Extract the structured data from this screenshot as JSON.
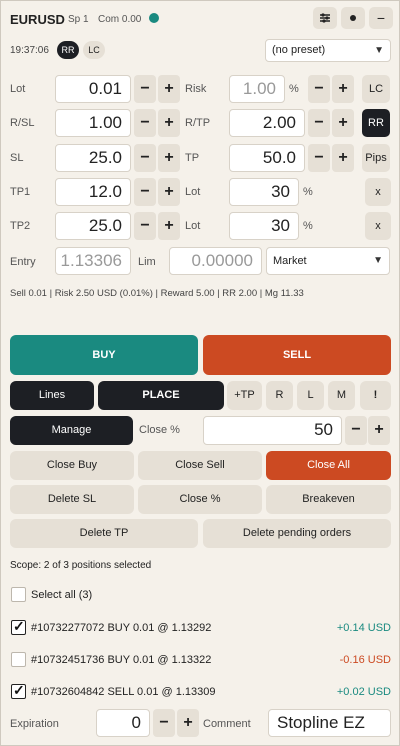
{
  "header": {
    "symbol": "EURUSD",
    "spread": "Sp 1",
    "commission": "Com 0.00",
    "status_color": "#1a8a80",
    "time": "19:37:06",
    "mode_rr": "RR",
    "mode_lc": "LC",
    "preset": "(no preset)"
  },
  "fields": {
    "lot_label": "Lot",
    "lot": "0.01",
    "risk_label": "Risk",
    "risk": "1.00",
    "risk_unit": "%",
    "rsl_label": "R/SL",
    "rsl": "1.00",
    "rtp_label": "R/TP",
    "rtp": "2.00",
    "sl_label": "SL",
    "sl": "25.0",
    "tp_label": "TP",
    "tp": "50.0",
    "tp1_label": "TP1",
    "tp1": "12.0",
    "tp1_lot_label": "Lot",
    "tp1_lot": "30",
    "tp1_lot_unit": "%",
    "tp2_label": "TP2",
    "tp2": "25.0",
    "tp2_lot_label": "Lot",
    "tp2_lot": "30",
    "tp2_lot_unit": "%",
    "entry_label": "Entry",
    "entry": "1.13306",
    "lim_label": "Lim",
    "lim": "0.00000",
    "order_type": "Market"
  },
  "side_buttons": {
    "lc": "LC",
    "rr": "RR",
    "pips": "Pips",
    "x1": "x",
    "x2": "x"
  },
  "stepper": {
    "minus": "−",
    "plus": "+"
  },
  "summary": "Sell 0.01 | Risk 2.50 USD (0.01%) | Reward 5.00 | RR 2.00 | Mg 11.33",
  "actions": {
    "buy": "BUY",
    "sell": "SELL",
    "lines": "Lines",
    "place": "PLACE",
    "plus_tp": "+TP",
    "r": "R",
    "l": "L",
    "m": "M",
    "bang": "!",
    "manage": "Manage",
    "close_pct_label": "Close %",
    "close_pct": "50",
    "close_buy": "Close Buy",
    "close_sell": "Close Sell",
    "close_all": "Close All",
    "delete_sl": "Delete SL",
    "close_pct_btn": "Close %",
    "breakeven": "Breakeven",
    "delete_tp": "Delete TP",
    "delete_pending": "Delete pending orders"
  },
  "scope": "Scope: 2 of 3 positions selected",
  "select_all": "Select all (3)",
  "positions": [
    {
      "text": "#10732277072  BUY 0.01 @ 1.13292",
      "pnl": "+0.14 USD",
      "checked": true
    },
    {
      "text": "#10732451736  BUY 0.01 @ 1.13322",
      "pnl": "-0.16 USD",
      "checked": false
    },
    {
      "text": "#10732604842  SELL 0.01 @ 1.13309",
      "pnl": "+0.02 USD",
      "checked": true
    }
  ],
  "footer": {
    "expiration_label": "Expiration",
    "expiration": "0",
    "comment_label": "Comment",
    "comment": "Stopline EZ"
  },
  "colors": {
    "buy": "#1a8a80",
    "sell": "#cc4a22",
    "positive": "#1a8a80",
    "negative": "#cc4a22",
    "dark": "#1d1f24"
  }
}
